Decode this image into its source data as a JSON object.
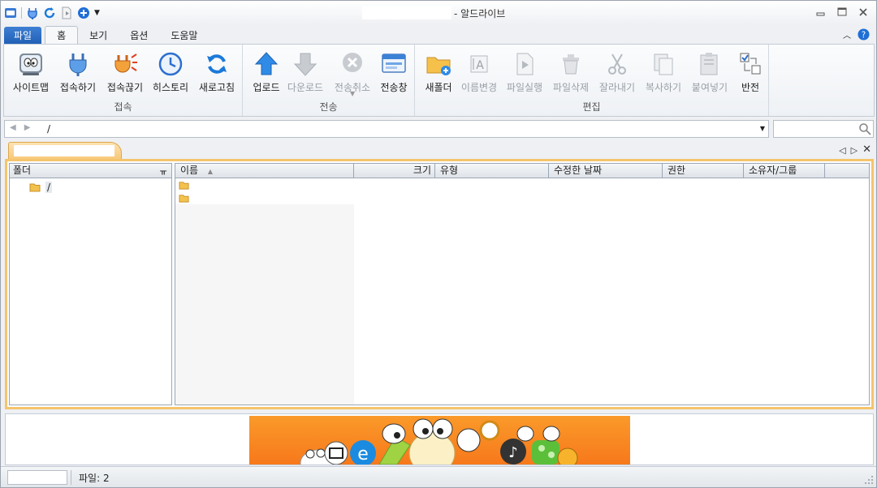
{
  "window": {
    "title": "- 알드라이브"
  },
  "ribbon_tabs": [
    {
      "label": "파일",
      "kind": "file"
    },
    {
      "label": "홈",
      "kind": "active"
    },
    {
      "label": "보기",
      "kind": "normal"
    },
    {
      "label": "옵션",
      "kind": "normal"
    },
    {
      "label": "도움말",
      "kind": "normal"
    }
  ],
  "groups": {
    "connect": {
      "label": "접속",
      "buttons": [
        "사이트맵",
        "접속하기",
        "접속끊기",
        "히스토리",
        "새로고침"
      ]
    },
    "transfer": {
      "label": "전송",
      "buttons": [
        "업로드",
        "다운로드",
        "전송취소",
        "전송창"
      ]
    },
    "edit": {
      "label": "편집",
      "buttons": [
        "새폴더",
        "이름변경",
        "파일실행",
        "파일삭제",
        "잘라내기",
        "복사하기",
        "붙여넣기",
        "반전"
      ]
    }
  },
  "address": {
    "path": "/"
  },
  "folder_panel": {
    "header": "폴더",
    "root_label": "/"
  },
  "file_panel": {
    "columns": [
      "이름",
      "크기",
      "유형",
      "수정한 날짜",
      "권한",
      "소유자/그룹"
    ]
  },
  "status": {
    "text": "파일: 2"
  },
  "colors": {
    "accent": "#1f5fb5",
    "highlight": "#f5c46d"
  }
}
